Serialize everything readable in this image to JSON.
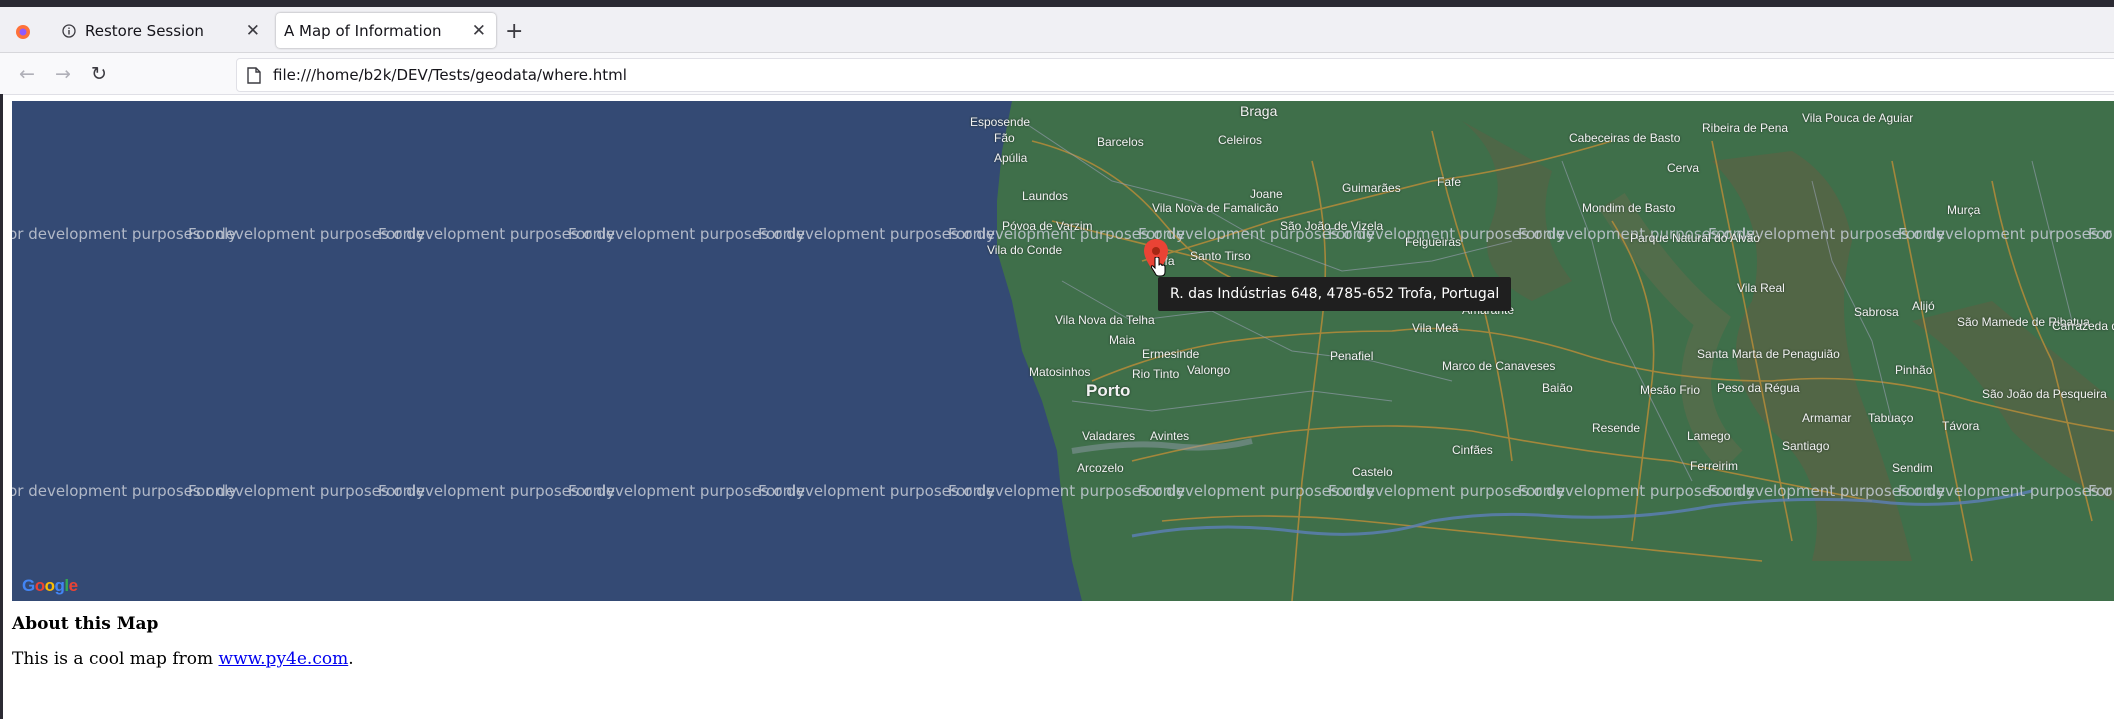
{
  "browser": {
    "tabs": [
      {
        "label": "Restore Session",
        "icon": "info-icon",
        "active": false
      },
      {
        "label": "A Map of Information",
        "icon": "",
        "active": true
      }
    ],
    "url": "file:///home/b2k/DEV/Tests/geodata/where.html"
  },
  "map": {
    "watermark": "For development purposes only",
    "marker_tooltip": "R. das Indústrias 648, 4785-652 Trofa, Portugal",
    "logo": "Google",
    "places": {
      "braga": "Braga",
      "esposende": "Esposende",
      "fao": "Fão",
      "barcelos": "Barcelos",
      "apulia": "Apúlia",
      "celeiros": "Celeiros",
      "cabeceiras": "Cabeceiras de Basto",
      "ribeira_pena": "Ribeira de Pena",
      "vila_pouca": "Vila Pouca de Aguiar",
      "cerva": "Cerva",
      "laundos": "Laundos",
      "joane": "Joane",
      "guimaraes": "Guimarães",
      "fafe": "Fafe",
      "vila_nova_famalicao": "Vila Nova de Famalicão",
      "povoa_varzim": "Póvoa de Varzim",
      "sao_joao_vizela": "São João de Vizela",
      "felgueiras": "Felgueiras",
      "mondim_basto": "Mondim de Basto",
      "parque_alvao": "Parque Natural do Alvão",
      "murca": "Murça",
      "vila_do_conde": "Vila do Conde",
      "trofa": "Trofa",
      "santo_tirso": "Santo Tirso",
      "amarante": "Amarante",
      "vila_real": "Vila Real",
      "alijo": "Alijó",
      "sabrosa": "Sabrosa",
      "sao_mamede": "São Mamede de Ribatua",
      "carrazeda": "Carrazeda de Ansiães",
      "vila_nova_telha": "Vila Nova da Telha",
      "maia": "Maia",
      "vila_mea": "Vila Meã",
      "ermesinde": "Ermesinde",
      "penafiel": "Penafiel",
      "matosinhos": "Matosinhos",
      "rio_tinto": "Rio Tinto",
      "valongo": "Valongo",
      "marco_canaveses": "Marco de Canaveses",
      "santa_marta": "Santa Marta de Penaguião",
      "pinhao": "Pinhão",
      "porto": "Porto",
      "baiao": "Baião",
      "mesao_frio": "Mesão Frio",
      "peso_regua": "Peso da Régua",
      "sao_joao_pesqueira": "São João da Pesqueira",
      "valadares": "Valadares",
      "avintes": "Avintes",
      "resende": "Resende",
      "lamego": "Lamego",
      "armamar": "Armamar",
      "tabuaco": "Tabuaço",
      "tavora": "Távora",
      "cinfaes": "Cinfães",
      "santiago": "Santiago",
      "arcozelo": "Arcozelo",
      "castelo": "Castelo",
      "ferreirim": "Ferreirim",
      "sendim": "Sendim"
    }
  },
  "page": {
    "heading": "About this Map",
    "text_before": "This is a cool map from ",
    "link_text": "www.py4e.com",
    "text_after": "."
  },
  "colors": {
    "sea": "#344a74",
    "land": "#3f6f4a",
    "marker": "#ea4335",
    "link": "#0000ee"
  }
}
